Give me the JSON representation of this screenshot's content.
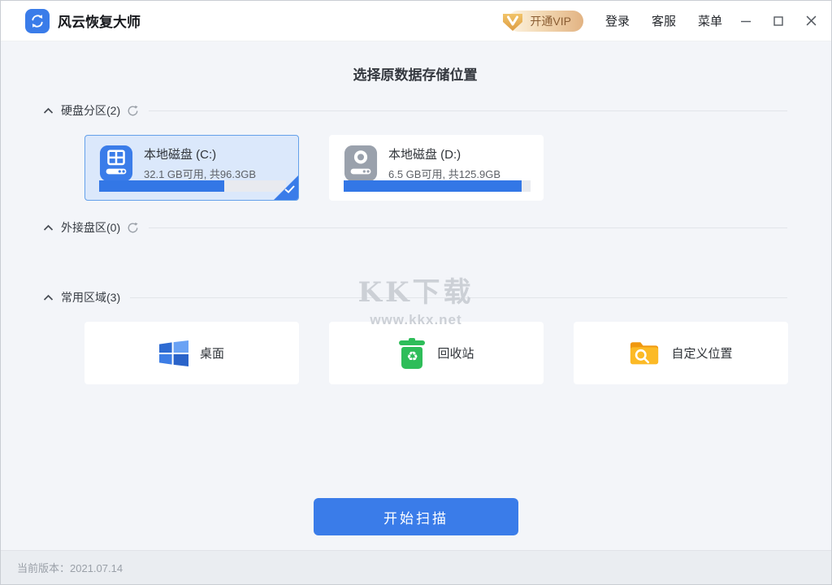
{
  "window": {
    "title": "风云恢复大师",
    "vip_button": "开通VIP",
    "nav": {
      "login": "登录",
      "support": "客服",
      "menu": "菜单"
    }
  },
  "page": {
    "heading": "选择原数据存储位置"
  },
  "sections": {
    "hdd": "硬盘分区(2)",
    "external": "外接盘区(0)",
    "common": "常用区域(3)"
  },
  "disks": [
    {
      "name": "本地磁盘 (C:)",
      "detail": "32.1 GB可用, 共96.3GB",
      "used_percent": 67,
      "selected": true
    },
    {
      "name": "本地磁盘 (D:)",
      "detail": "6.5 GB可用, 共125.9GB",
      "used_percent": 95,
      "selected": false
    }
  ],
  "locations": [
    {
      "label": "桌面",
      "icon": "windows-logo-icon"
    },
    {
      "label": "回收站",
      "icon": "recycle-bin-icon"
    },
    {
      "label": "自定义位置",
      "icon": "folder-search-icon"
    }
  ],
  "watermark": {
    "title": "KK下载",
    "url": "www.kkx.net"
  },
  "actions": {
    "scan": "开始扫描"
  },
  "footer": {
    "version": "当前版本：2021.07.14"
  },
  "icons": {
    "app_logo": "sync-arrows",
    "chevron": "collapse-up",
    "refresh": "reload-arrow",
    "minimize": "—",
    "maximize": "▢",
    "close": "✕",
    "selected_check": "✓",
    "recycle_glyph": "♻"
  },
  "colors": {
    "accent_blue": "#3a7ce9",
    "progress_blue": "#3377e6",
    "selected_card_bg": "#dbe8fb",
    "selected_card_border": "#63a0ea",
    "recycle_green": "#2ebd59",
    "folder_orange": "#f8a91c",
    "vip_text": "#8a5d33",
    "main_bg": "#f3f5f9",
    "footer_bg": "#eaedf1"
  }
}
